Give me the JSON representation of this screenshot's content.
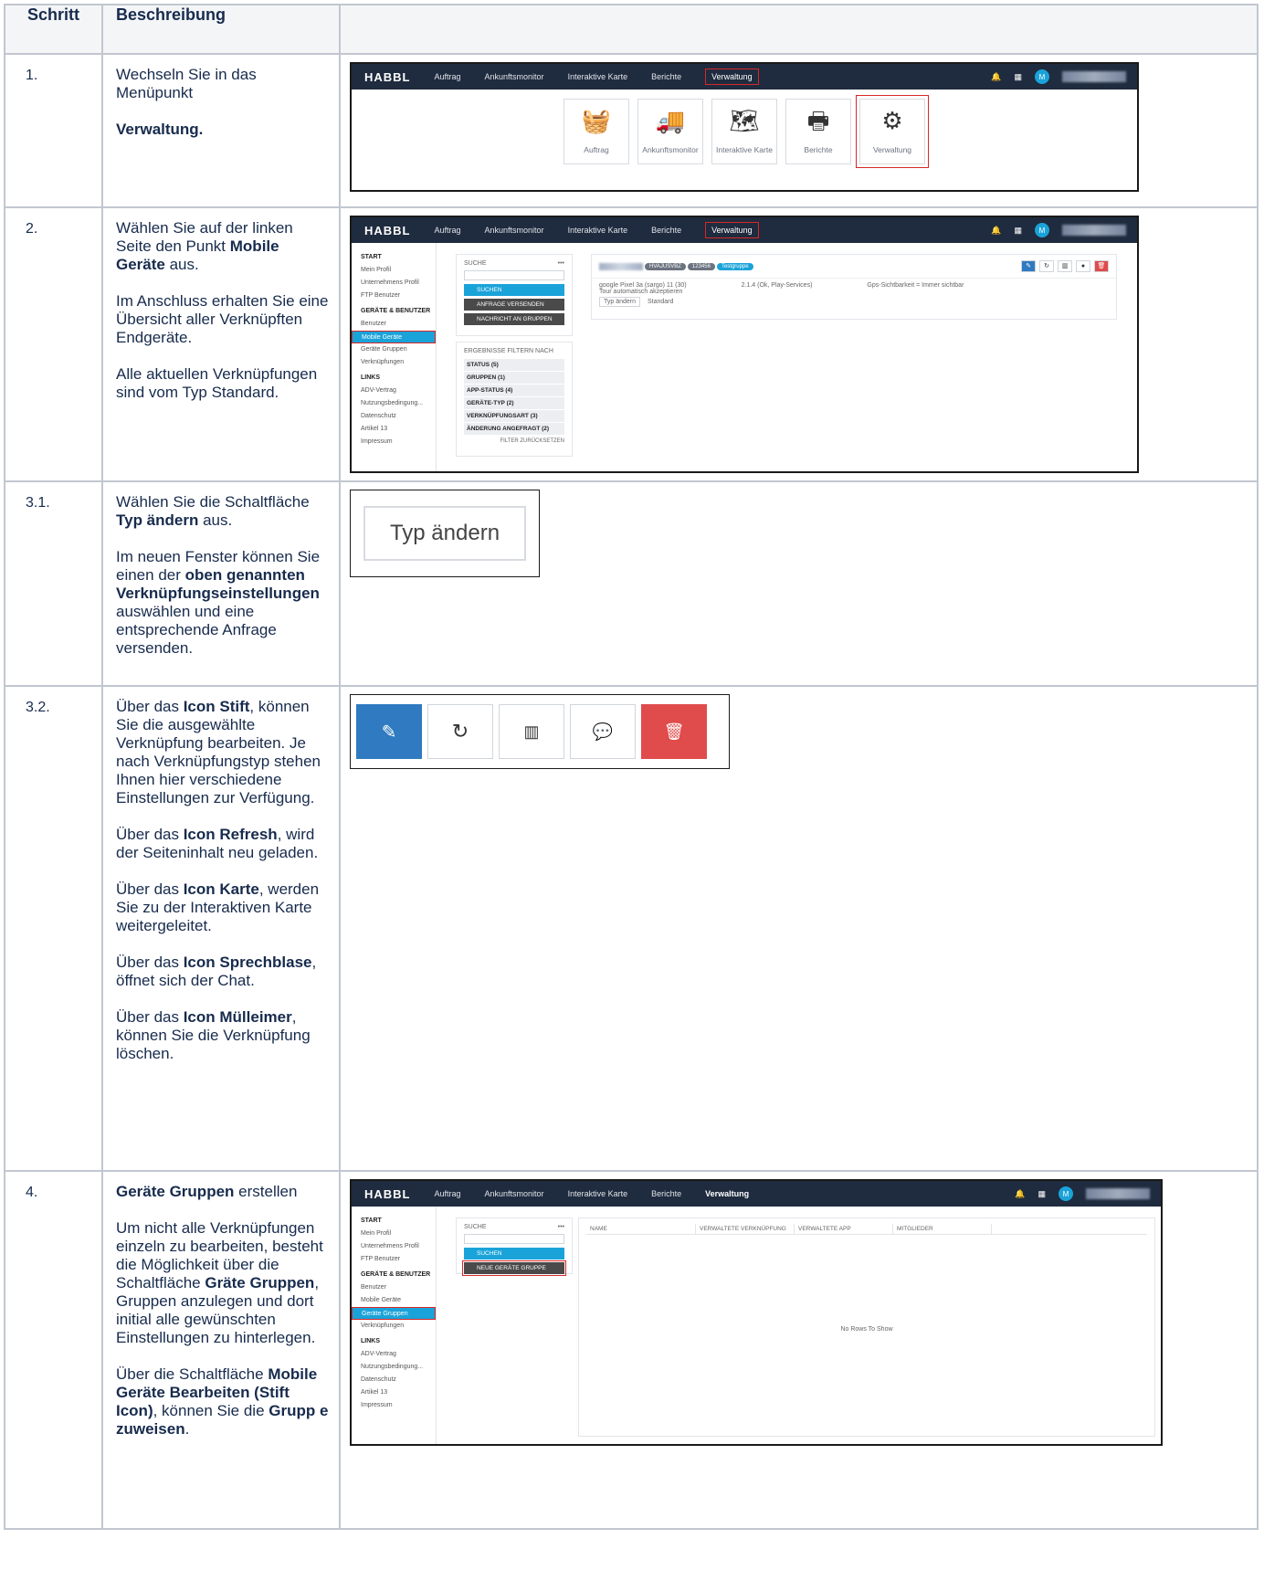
{
  "header": {
    "col1": "Schritt",
    "col2": "Beschreibung",
    "col3": ""
  },
  "rows": {
    "r1": {
      "step": "1.",
      "p1": "Wechseln Sie in das Menüpunkt",
      "p2": "Verwaltung."
    },
    "r2": {
      "step": "2.",
      "p1a": "Wählen Sie auf der linken Seite den Punkt ",
      "p1b": "Mobile Geräte",
      "p1c": " aus.",
      "p2": "Im Anschluss erhalten Sie eine Übersicht aller Verknüpften Endgeräte.",
      "p3": "Alle aktuellen Verknüpfungen sind vom Typ Standard."
    },
    "r3": {
      "step": "3.1.",
      "p1a": "Wählen Sie die Schaltfläche ",
      "p1b": "Typ ändern",
      "p1c": " aus.",
      "p2a": "Im neuen Fenster können Sie einen der ",
      "p2b": "oben genannten Verknüpfungseinstellungen",
      "p2c": " auswählen und eine entsprechende Anfrage versenden."
    },
    "r4": {
      "step": "3.2.",
      "p1a": "Über das ",
      "p1b": "Icon Stift",
      "p1c": ", können Sie die ausgewählte Verknüpfung bearbeiten. Je nach Verknüpfungstyp stehen Ihnen hier verschiedene Einstellungen zur Verfügung.",
      "p2a": "Über das ",
      "p2b": "Icon Refresh",
      "p2c": ", wird der Seiteninhalt neu geladen.",
      "p3a": "Über das ",
      "p3b": "Icon Karte",
      "p3c": ", werden Sie zu der Interaktiven Karte weitergeleitet.",
      "p4a": "Über das ",
      "p4b": "Icon Sprechblase",
      "p4c": ", öffnet sich der Chat.",
      "p5a": "Über das ",
      "p5b": "Icon Mülleimer",
      "p5c": ", können Sie die Verknüpfung löschen."
    },
    "r5": {
      "step": "4.",
      "p1b": "Geräte Gruppen",
      "p1c": " erstellen",
      "p2a": "Um nicht alle Verknüpfungen einzeln zu bearbeiten, besteht die Möglichkeit über die Schaltfläche ",
      "p2b": "Gräte Gruppen",
      "p2c": ", Gruppen anzulegen und dort initial alle gewünschten Einstellungen zu hinterlegen.",
      "p3a": "Über die Schaltfläche ",
      "p3b": "Mobile Geräte  Bearbeiten (Stift Icon)",
      "p3c": ", können Sie die ",
      "p3d": "Grupp e zuweisen",
      "p3e": "."
    }
  },
  "app": {
    "logo": "HABBL",
    "nav": [
      "Auftrag",
      "Ankunftsmonitor",
      "Interaktive Karte",
      "Berichte",
      "Verwaltung"
    ],
    "avatar": "M",
    "tiles": [
      "Auftrag",
      "Ankunftsmonitor",
      "Interaktive Karte",
      "Berichte",
      "Verwaltung"
    ],
    "side": {
      "start": "START",
      "profile": "Mein Profil",
      "company": "Unternehmens Profil",
      "ftp": "FTP Benutzer",
      "devhead": "GERÄTE & BENUTZER",
      "users": "Benutzer",
      "mobile": "Mobile Geräte",
      "groups": "Geräte Gruppen",
      "links_item": "Verknüpfungen",
      "links": "LINKS",
      "adv": "ADV-Vertrag",
      "terms": "Nutzungsbedingung...",
      "privacy": "Datenschutz",
      "art": "Artikel 13",
      "imprint": "Impressum"
    },
    "search": "SUCHE",
    "dots": "•••",
    "search_btn": "SUCHEN",
    "send_btn": "ANFRAGE VERSENDEN",
    "msg_btn": "NACHRICHT AN GRUPPEN",
    "new_group_btn": "NEUE GERÄTE GRUPPE",
    "filter_head": "ERGEBNISSE FILTERN NACH",
    "filters": [
      "STATUS (5)",
      "GRUPPEN (1)",
      "APP-STATUS (4)",
      "GERÄTE-TYP (2)",
      "VERKNÜPFUNGSART (3)",
      "ÄNDERUNG ANGEFRAGT (2)"
    ],
    "filter_reset": "FILTER ZURÜCKSETZEN",
    "chips": [
      "HVAJUSVBZ",
      "123456",
      "Testgruppe"
    ],
    "dev_line1": "google Pixel 3a (sargo) 11 (30)",
    "dev_line2": "Tour automatisch akzeptieren",
    "app_ver": "2.1.4 (Ok, Play-Services)",
    "gps": "Gps-Sichtbarkeit = Immer sichtbar",
    "type_btn": "Typ ändern",
    "type_val": "Standard",
    "cols": [
      "NAME",
      "VERWALTETE VERKNÜPFUNG",
      "VERWALTETE APP",
      "MITGLIEDER"
    ],
    "empty": "No Rows To Show",
    "colors": {
      "nav": "#1f2b3e",
      "accent": "#1aa3d9",
      "edit": "#2f7ac0",
      "delete": "#e04b4b",
      "highlight": "#d62828"
    }
  }
}
